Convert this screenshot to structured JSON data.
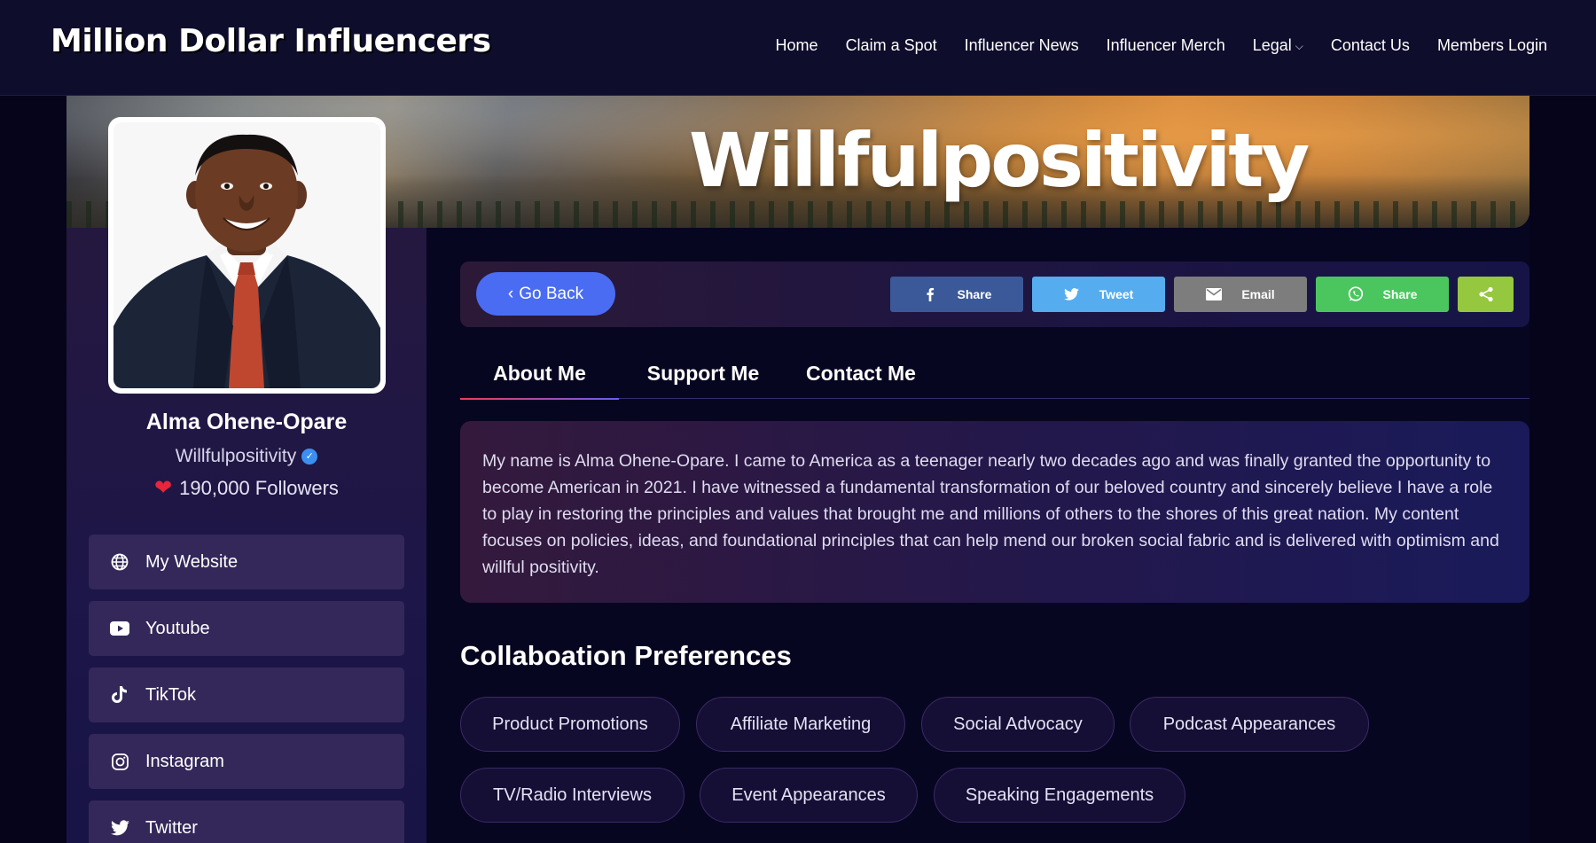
{
  "brand": "Million Dollar Influencers",
  "nav": {
    "items": [
      {
        "label": "Home"
      },
      {
        "label": "Claim a Spot"
      },
      {
        "label": "Influencer News"
      },
      {
        "label": "Influencer Merch"
      },
      {
        "label": "Legal"
      },
      {
        "label": "Contact Us"
      },
      {
        "label": "Members Login"
      }
    ]
  },
  "banner": {
    "title": "Willfulpositivity"
  },
  "profile": {
    "name": "Alma Ohene-Opare",
    "handle": "Willfulpositivity",
    "followers": "190,000 Followers"
  },
  "social": [
    {
      "label": "My Website",
      "icon": "globe-icon"
    },
    {
      "label": "Youtube",
      "icon": "youtube-icon"
    },
    {
      "label": "TikTok",
      "icon": "tiktok-icon"
    },
    {
      "label": "Instagram",
      "icon": "instagram-icon"
    },
    {
      "label": "Twitter",
      "icon": "twitter-icon"
    }
  ],
  "actions": {
    "go_back": "Go Back",
    "share_buttons": [
      {
        "label": "Share",
        "icon": "facebook-icon",
        "color": "#3b5998"
      },
      {
        "label": "Tweet",
        "icon": "twitter-icon",
        "color": "#55acee"
      },
      {
        "label": "Email",
        "icon": "email-icon",
        "color": "#7d7d7d"
      },
      {
        "label": "Share",
        "icon": "whatsapp-icon",
        "color": "#4bc65f"
      },
      {
        "label": "",
        "icon": "share-icon",
        "color": "#95c73f"
      }
    ]
  },
  "tabs": [
    {
      "label": "About Me",
      "active": true
    },
    {
      "label": "Support Me",
      "active": false
    },
    {
      "label": "Contact Me",
      "active": false
    }
  ],
  "about": "My name is Alma Ohene-Opare. I came to America as a teenager nearly two decades ago and was finally granted the opportunity to become American in 2021. I have witnessed a fundamental transformation of our beloved country and sincerely believe I have a role to play in restoring the principles and values that brought me and millions of others to the shores of this great nation. My content focuses on policies, ideas, and foundational principles that can help mend our broken social fabric and is delivered with optimism and willful positivity.",
  "collab": {
    "title": "Collaboation Preferences",
    "items": [
      "Product Promotions",
      "Affiliate Marketing",
      "Social Advocacy",
      "Podcast Appearances",
      "TV/Radio Interviews",
      "Event Appearances",
      "Speaking Engagements"
    ]
  },
  "colors": {
    "nav_bg": "#0e0d2c",
    "accent_blue": "#4a6cf3",
    "heart": "#e8253a",
    "verified": "#3b8ff0"
  }
}
